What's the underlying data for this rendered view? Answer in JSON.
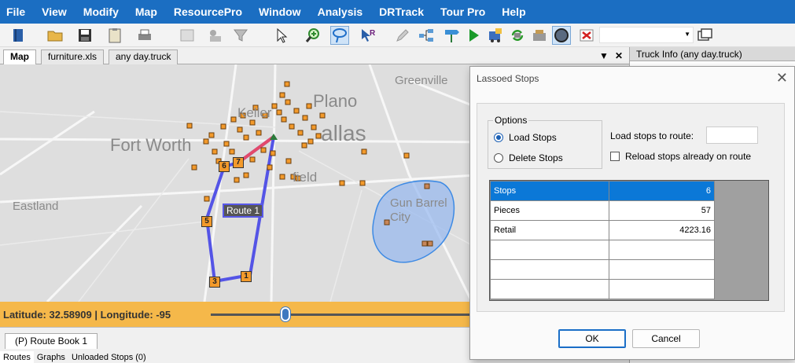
{
  "menu": [
    "File",
    "View",
    "Modify",
    "Map",
    "ResourcePro",
    "Window",
    "Analysis",
    "DRTrack",
    "Tour Pro",
    "Help"
  ],
  "tabs": [
    "Map",
    "furniture.xls",
    "any day.truck"
  ],
  "right_panel": {
    "header": "Truck Info (any day.truck)"
  },
  "map": {
    "places": [
      "Greenville",
      "Plano",
      "Keller",
      "allas",
      "Fort Worth",
      "field",
      "Eastland",
      "Gun Barrel City"
    ],
    "route_label": "Route 1",
    "stop_numbers": [
      "7",
      "6",
      "5",
      "3",
      "1"
    ],
    "route_color": "#5454e6",
    "lasso_color": "#6f9fe8",
    "stop_color": "#f39a2b"
  },
  "status": {
    "coords": "Latitude: 32.58909 | Longitude: -95"
  },
  "bottom": {
    "route_book_tab": "(P) Route Book 1",
    "subtabs": [
      "Routes",
      "Graphs",
      "Unloaded Stops (0)"
    ]
  },
  "dialog": {
    "title": "Lassoed Stops",
    "options_label": "Options",
    "radio_load": "Load Stops",
    "radio_delete": "Delete Stops",
    "load_to_label": "Load stops to route:",
    "load_to_value": "",
    "reload_label": "Reload stops already on route",
    "rows": [
      {
        "label": "Stops",
        "value": "6"
      },
      {
        "label": "Pieces",
        "value": "57"
      },
      {
        "label": "Retail",
        "value": "4223.16"
      },
      {
        "label": "",
        "value": ""
      },
      {
        "label": "",
        "value": ""
      },
      {
        "label": "",
        "value": ""
      }
    ],
    "ok": "OK",
    "cancel": "Cancel"
  }
}
